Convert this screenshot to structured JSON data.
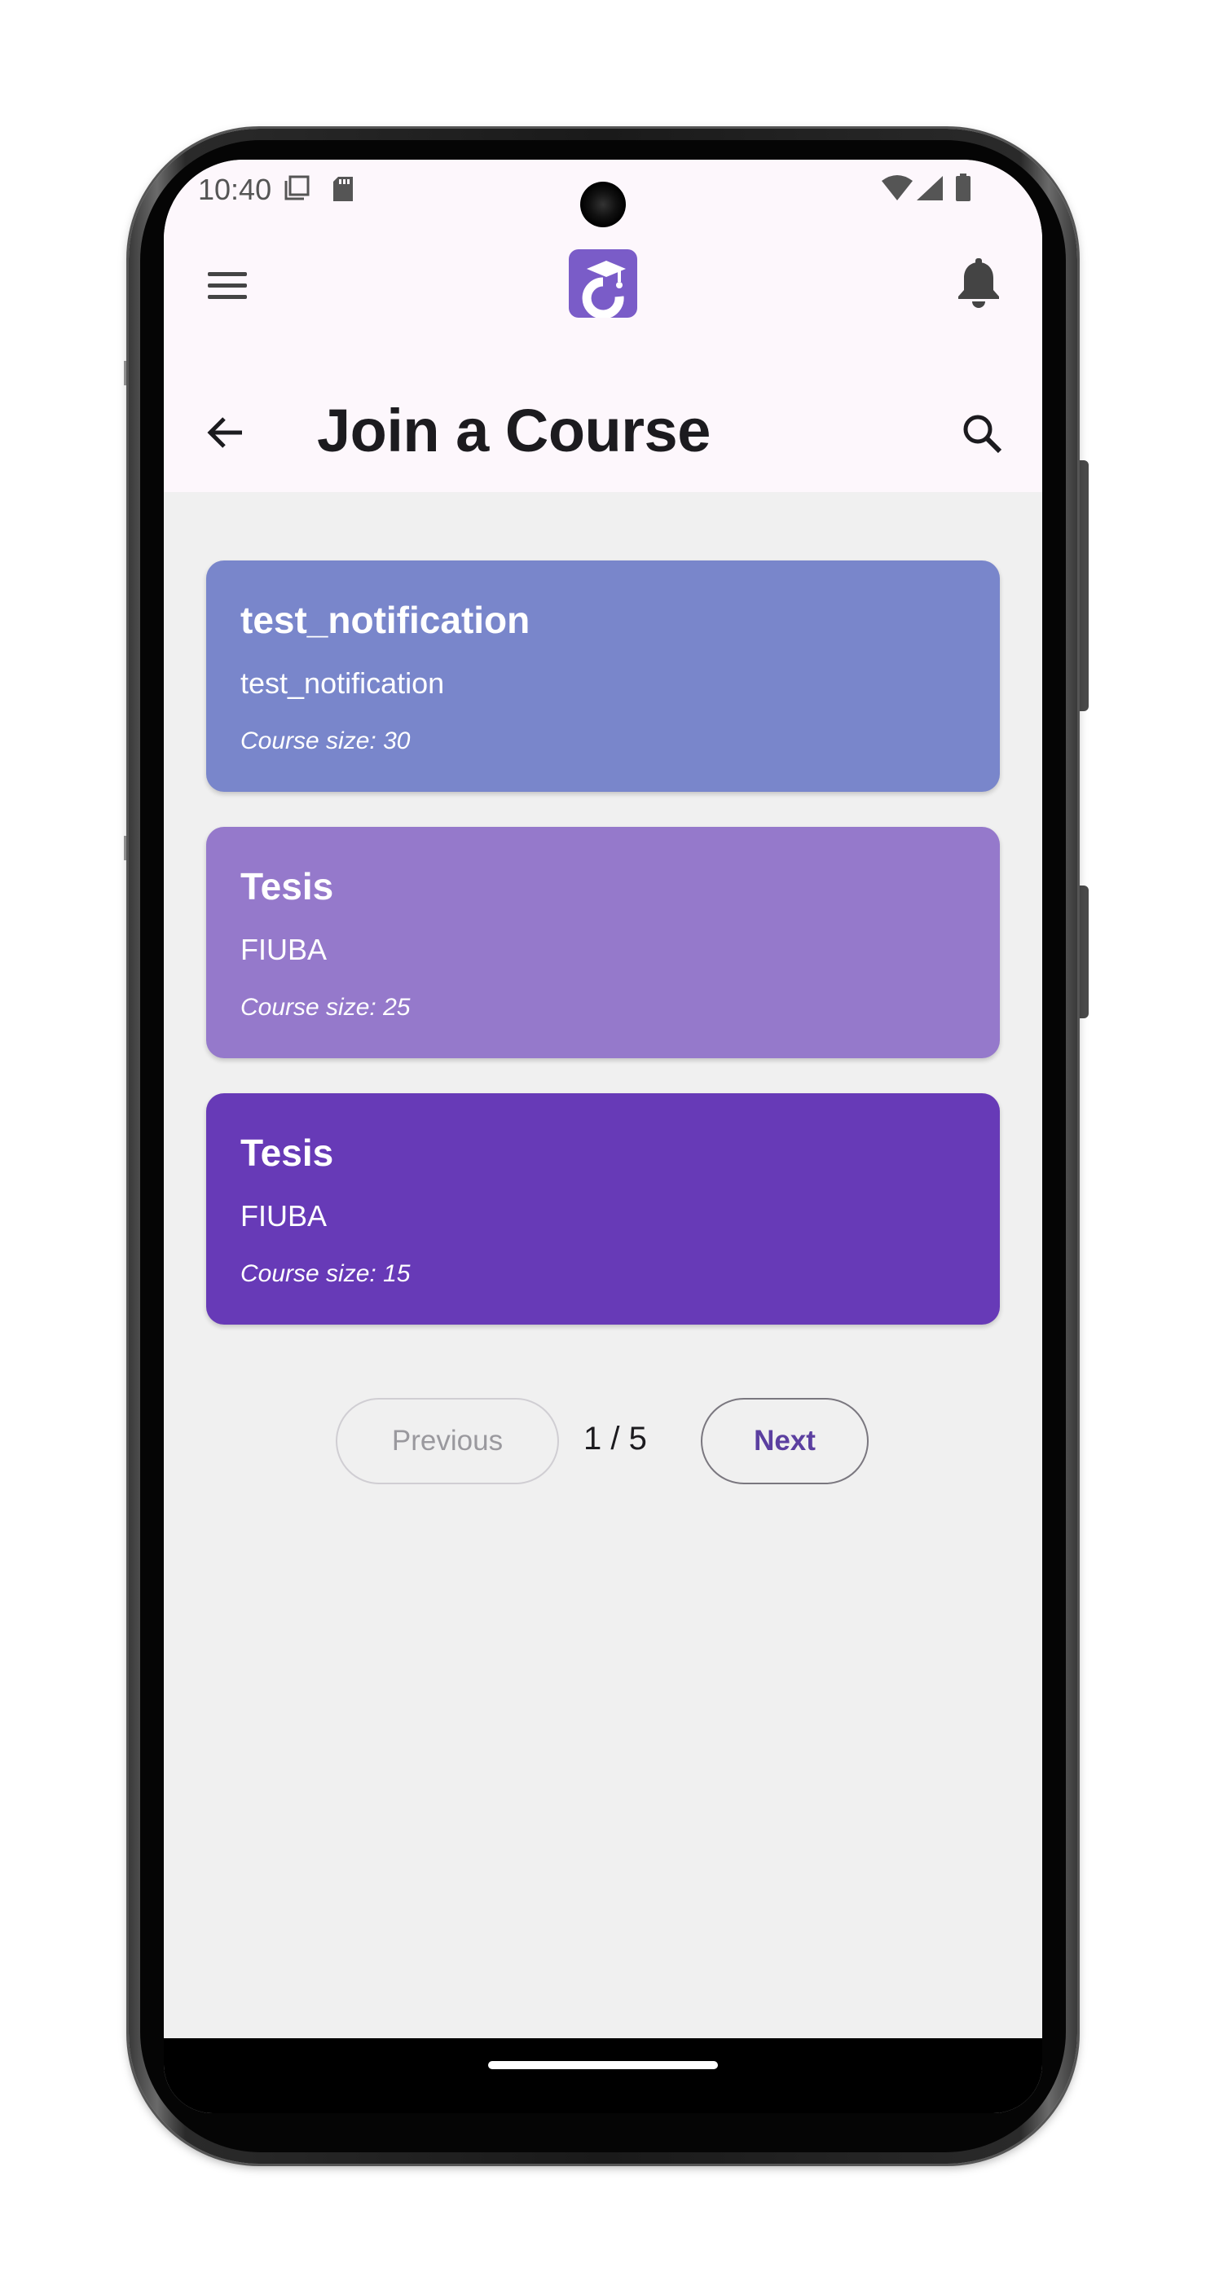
{
  "status_bar": {
    "time": "10:40",
    "icons": [
      "screenshot-icon",
      "sd-card-icon",
      "wifi-icon",
      "signal-icon",
      "battery-icon"
    ]
  },
  "app_bar": {
    "menu_icon": "menu-icon",
    "logo_icon": "app-logo-icon",
    "notification_icon": "bell-icon"
  },
  "header": {
    "title": "Join a Course",
    "back_icon": "arrow-back-icon",
    "search_icon": "search-icon"
  },
  "courses": [
    {
      "title": "test_notification",
      "subtitle": "test_notification",
      "size_text": "Course size: 30",
      "color": "#7986cb"
    },
    {
      "title": "Tesis",
      "subtitle": "FIUBA",
      "size_text": "Course size: 25",
      "color": "#9579cb"
    },
    {
      "title": "Tesis",
      "subtitle": "FIUBA",
      "size_text": "Course size: 15",
      "color": "#673ab7"
    }
  ],
  "pagination": {
    "previous_label": "Previous",
    "next_label": "Next",
    "page_indicator": "1 / 5"
  },
  "colors": {
    "top_bar_bg": "#fdf7fc",
    "content_bg": "#f0f0f0",
    "accent": "#7a5cc8",
    "next_text": "#5b3fa0"
  }
}
